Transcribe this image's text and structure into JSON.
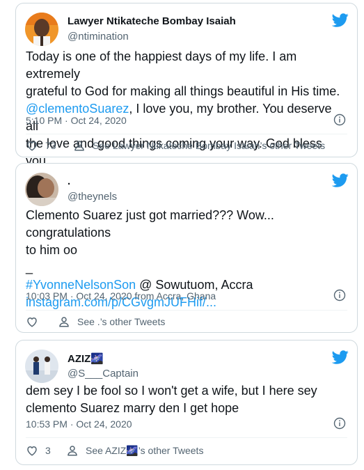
{
  "tweets": [
    {
      "name": "Lawyer Ntikateche Bombay Isaiah",
      "handle": "@ntimination",
      "text_line1": "Today is one of the happiest days of my life. I am extremely",
      "text_line2": "grateful to God for making all things beautiful in His time.",
      "mention": "@clementoSuarez",
      "text_line3_rest": ", I love you, my brother. You deserve all",
      "text_line4": "the love and good things coming your way. God bless you.",
      "timestamp": "5:10 PM · Oct 24, 2020",
      "likes": "73",
      "other_tweets": "See Lawyer Ntikateche Bombay Isaiah’s other Tweets"
    },
    {
      "name": ".",
      "handle": "@theynels",
      "text_line1": "Clemento Suarez just got married??? Wow... congratulations",
      "text_line2": "to him oo",
      "text_line3": "_",
      "hashtag": "#YvonneNelsonSon",
      "location_text": " @ Sowutuom, Accra",
      "url": "instagram.com/p/CGvgmJUFHif/...",
      "timestamp": "10:03 PM · Oct 24, 2020 from Accra, Ghana",
      "likes": "",
      "other_tweets": "See .’s other Tweets"
    },
    {
      "name": "AZIZ",
      "name_emoji": "🌌",
      "handle": "@S___Captain",
      "text_line1": "dem sey I be fool so I won't get a wife, but I here sey",
      "text_line2": "clemento Suarez marry den I get hope",
      "timestamp": "10:53 PM · Oct 24, 2020",
      "likes": "3",
      "other_tweets_prefix": "See AZIZ",
      "other_tweets_suffix": "’s other Tweets"
    }
  ],
  "colors": {
    "twitter_blue": "#1d9bf0",
    "text": "#0f1419",
    "muted": "#536471",
    "border": "#cfd9de"
  }
}
